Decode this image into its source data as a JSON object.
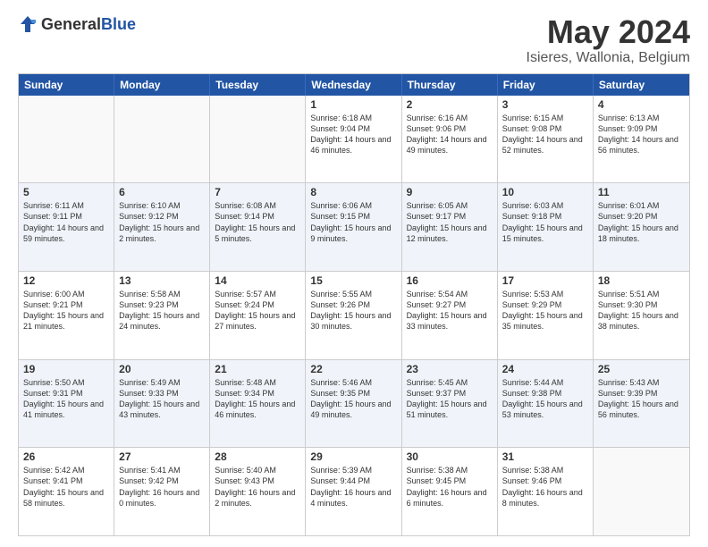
{
  "header": {
    "logo_general": "General",
    "logo_blue": "Blue",
    "month_title": "May 2024",
    "location": "Isieres, Wallonia, Belgium"
  },
  "days_of_week": [
    "Sunday",
    "Monday",
    "Tuesday",
    "Wednesday",
    "Thursday",
    "Friday",
    "Saturday"
  ],
  "weeks": [
    {
      "alt": false,
      "days": [
        {
          "num": "",
          "sunrise": "",
          "sunset": "",
          "daylight": "",
          "empty": true
        },
        {
          "num": "",
          "sunrise": "",
          "sunset": "",
          "daylight": "",
          "empty": true
        },
        {
          "num": "",
          "sunrise": "",
          "sunset": "",
          "daylight": "",
          "empty": true
        },
        {
          "num": "1",
          "sunrise": "Sunrise: 6:18 AM",
          "sunset": "Sunset: 9:04 PM",
          "daylight": "Daylight: 14 hours and 46 minutes.",
          "empty": false
        },
        {
          "num": "2",
          "sunrise": "Sunrise: 6:16 AM",
          "sunset": "Sunset: 9:06 PM",
          "daylight": "Daylight: 14 hours and 49 minutes.",
          "empty": false
        },
        {
          "num": "3",
          "sunrise": "Sunrise: 6:15 AM",
          "sunset": "Sunset: 9:08 PM",
          "daylight": "Daylight: 14 hours and 52 minutes.",
          "empty": false
        },
        {
          "num": "4",
          "sunrise": "Sunrise: 6:13 AM",
          "sunset": "Sunset: 9:09 PM",
          "daylight": "Daylight: 14 hours and 56 minutes.",
          "empty": false
        }
      ]
    },
    {
      "alt": true,
      "days": [
        {
          "num": "5",
          "sunrise": "Sunrise: 6:11 AM",
          "sunset": "Sunset: 9:11 PM",
          "daylight": "Daylight: 14 hours and 59 minutes.",
          "empty": false
        },
        {
          "num": "6",
          "sunrise": "Sunrise: 6:10 AM",
          "sunset": "Sunset: 9:12 PM",
          "daylight": "Daylight: 15 hours and 2 minutes.",
          "empty": false
        },
        {
          "num": "7",
          "sunrise": "Sunrise: 6:08 AM",
          "sunset": "Sunset: 9:14 PM",
          "daylight": "Daylight: 15 hours and 5 minutes.",
          "empty": false
        },
        {
          "num": "8",
          "sunrise": "Sunrise: 6:06 AM",
          "sunset": "Sunset: 9:15 PM",
          "daylight": "Daylight: 15 hours and 9 minutes.",
          "empty": false
        },
        {
          "num": "9",
          "sunrise": "Sunrise: 6:05 AM",
          "sunset": "Sunset: 9:17 PM",
          "daylight": "Daylight: 15 hours and 12 minutes.",
          "empty": false
        },
        {
          "num": "10",
          "sunrise": "Sunrise: 6:03 AM",
          "sunset": "Sunset: 9:18 PM",
          "daylight": "Daylight: 15 hours and 15 minutes.",
          "empty": false
        },
        {
          "num": "11",
          "sunrise": "Sunrise: 6:01 AM",
          "sunset": "Sunset: 9:20 PM",
          "daylight": "Daylight: 15 hours and 18 minutes.",
          "empty": false
        }
      ]
    },
    {
      "alt": false,
      "days": [
        {
          "num": "12",
          "sunrise": "Sunrise: 6:00 AM",
          "sunset": "Sunset: 9:21 PM",
          "daylight": "Daylight: 15 hours and 21 minutes.",
          "empty": false
        },
        {
          "num": "13",
          "sunrise": "Sunrise: 5:58 AM",
          "sunset": "Sunset: 9:23 PM",
          "daylight": "Daylight: 15 hours and 24 minutes.",
          "empty": false
        },
        {
          "num": "14",
          "sunrise": "Sunrise: 5:57 AM",
          "sunset": "Sunset: 9:24 PM",
          "daylight": "Daylight: 15 hours and 27 minutes.",
          "empty": false
        },
        {
          "num": "15",
          "sunrise": "Sunrise: 5:55 AM",
          "sunset": "Sunset: 9:26 PM",
          "daylight": "Daylight: 15 hours and 30 minutes.",
          "empty": false
        },
        {
          "num": "16",
          "sunrise": "Sunrise: 5:54 AM",
          "sunset": "Sunset: 9:27 PM",
          "daylight": "Daylight: 15 hours and 33 minutes.",
          "empty": false
        },
        {
          "num": "17",
          "sunrise": "Sunrise: 5:53 AM",
          "sunset": "Sunset: 9:29 PM",
          "daylight": "Daylight: 15 hours and 35 minutes.",
          "empty": false
        },
        {
          "num": "18",
          "sunrise": "Sunrise: 5:51 AM",
          "sunset": "Sunset: 9:30 PM",
          "daylight": "Daylight: 15 hours and 38 minutes.",
          "empty": false
        }
      ]
    },
    {
      "alt": true,
      "days": [
        {
          "num": "19",
          "sunrise": "Sunrise: 5:50 AM",
          "sunset": "Sunset: 9:31 PM",
          "daylight": "Daylight: 15 hours and 41 minutes.",
          "empty": false
        },
        {
          "num": "20",
          "sunrise": "Sunrise: 5:49 AM",
          "sunset": "Sunset: 9:33 PM",
          "daylight": "Daylight: 15 hours and 43 minutes.",
          "empty": false
        },
        {
          "num": "21",
          "sunrise": "Sunrise: 5:48 AM",
          "sunset": "Sunset: 9:34 PM",
          "daylight": "Daylight: 15 hours and 46 minutes.",
          "empty": false
        },
        {
          "num": "22",
          "sunrise": "Sunrise: 5:46 AM",
          "sunset": "Sunset: 9:35 PM",
          "daylight": "Daylight: 15 hours and 49 minutes.",
          "empty": false
        },
        {
          "num": "23",
          "sunrise": "Sunrise: 5:45 AM",
          "sunset": "Sunset: 9:37 PM",
          "daylight": "Daylight: 15 hours and 51 minutes.",
          "empty": false
        },
        {
          "num": "24",
          "sunrise": "Sunrise: 5:44 AM",
          "sunset": "Sunset: 9:38 PM",
          "daylight": "Daylight: 15 hours and 53 minutes.",
          "empty": false
        },
        {
          "num": "25",
          "sunrise": "Sunrise: 5:43 AM",
          "sunset": "Sunset: 9:39 PM",
          "daylight": "Daylight: 15 hours and 56 minutes.",
          "empty": false
        }
      ]
    },
    {
      "alt": false,
      "days": [
        {
          "num": "26",
          "sunrise": "Sunrise: 5:42 AM",
          "sunset": "Sunset: 9:41 PM",
          "daylight": "Daylight: 15 hours and 58 minutes.",
          "empty": false
        },
        {
          "num": "27",
          "sunrise": "Sunrise: 5:41 AM",
          "sunset": "Sunset: 9:42 PM",
          "daylight": "Daylight: 16 hours and 0 minutes.",
          "empty": false
        },
        {
          "num": "28",
          "sunrise": "Sunrise: 5:40 AM",
          "sunset": "Sunset: 9:43 PM",
          "daylight": "Daylight: 16 hours and 2 minutes.",
          "empty": false
        },
        {
          "num": "29",
          "sunrise": "Sunrise: 5:39 AM",
          "sunset": "Sunset: 9:44 PM",
          "daylight": "Daylight: 16 hours and 4 minutes.",
          "empty": false
        },
        {
          "num": "30",
          "sunrise": "Sunrise: 5:38 AM",
          "sunset": "Sunset: 9:45 PM",
          "daylight": "Daylight: 16 hours and 6 minutes.",
          "empty": false
        },
        {
          "num": "31",
          "sunrise": "Sunrise: 5:38 AM",
          "sunset": "Sunset: 9:46 PM",
          "daylight": "Daylight: 16 hours and 8 minutes.",
          "empty": false
        },
        {
          "num": "",
          "sunrise": "",
          "sunset": "",
          "daylight": "",
          "empty": true
        }
      ]
    }
  ]
}
